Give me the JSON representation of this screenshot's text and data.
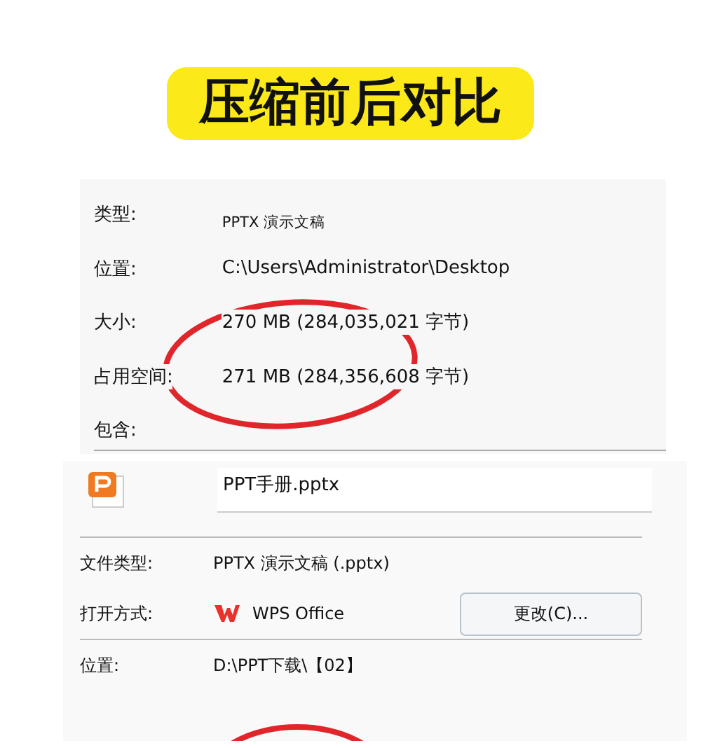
{
  "banner": {
    "title": "压缩前后对比"
  },
  "before": {
    "rows": [
      {
        "label": "类型:",
        "value": "PPTX 演示文稿",
        "kind": "small"
      },
      {
        "label": "位置:",
        "value": "C:\\Users\\Administrator\\Desktop",
        "kind": "text"
      },
      {
        "label": "大小:",
        "value": "270 MB (284,035,021 字节)",
        "kind": "text"
      },
      {
        "label": "占用空间:",
        "value": "271 MB (284,356,608 字节)",
        "kind": "text"
      },
      {
        "label": "包含:",
        "kind": "text"
      }
    ]
  },
  "after": {
    "file_name": "PPT手册.pptx",
    "rows": [
      {
        "label": "文件类型:",
        "value": "PPTX 演示文稿 (.pptx)",
        "kind": "text"
      },
      {
        "label": "打开方式:",
        "value": "WPS Office",
        "kind": "app",
        "button": "更改(C)..."
      },
      {
        "label": "位置:",
        "value": "D:\\PPT下载\\【02】",
        "kind": "text"
      }
    ]
  }
}
